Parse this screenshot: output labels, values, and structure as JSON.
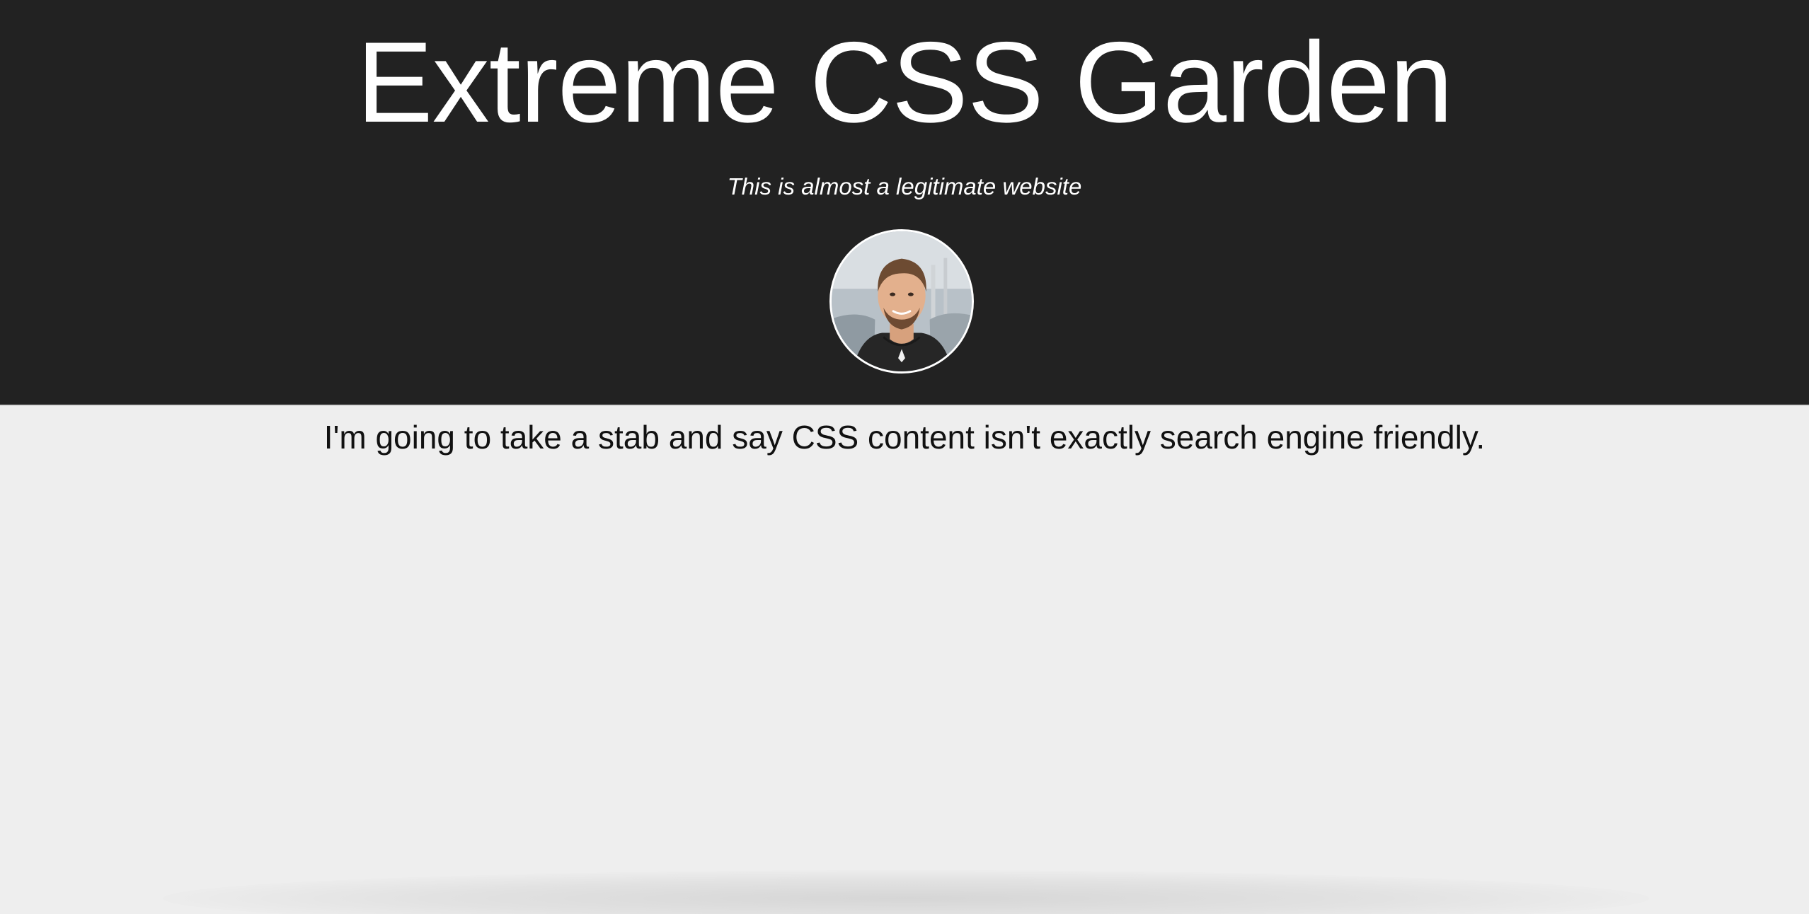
{
  "header": {
    "title": "Extreme CSS Garden",
    "tagline": "This is almost a legitimate website",
    "avatar_icon": "profile-photo-icon"
  },
  "main": {
    "intro": "I'm going to take a stab and say CSS content isn't exactly search engine friendly."
  },
  "colors": {
    "header_background": "#222222",
    "page_background": "#eeeeee",
    "header_text": "#ffffff",
    "body_text": "#111111"
  }
}
